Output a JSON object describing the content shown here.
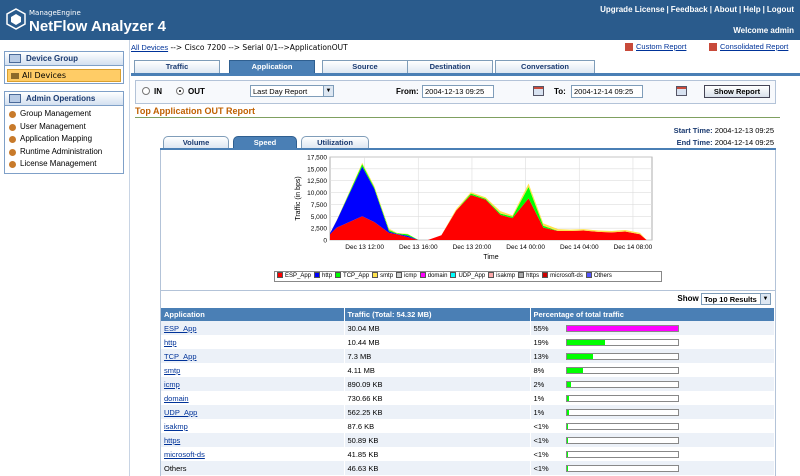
{
  "app": {
    "brand_small": "ManageEngine",
    "brand_name": "NetFlow Analyzer 4",
    "links": [
      "Upgrade License",
      "Feedback",
      "About",
      "Help",
      "Logout"
    ],
    "welcome": "Welcome admin"
  },
  "sidebar": {
    "device_group_title": "Device Group",
    "device_group_item": "All Devices",
    "admin_title": "Admin Operations",
    "admin_items": [
      "Group Management",
      "User Management",
      "Application Mapping",
      "Runtime Administration",
      "License Management"
    ]
  },
  "breadcrumb": {
    "root": "All Devices",
    "path": " --> Cisco 7200 --> Serial 0/1-->ApplicationOUT"
  },
  "report_links": {
    "custom": "Custom Report",
    "consolidated": "Consolidated Report"
  },
  "tabs": [
    "Traffic",
    "Application",
    "Source",
    "Destination",
    "Conversation"
  ],
  "filter": {
    "in_label": "IN",
    "out_label": "OUT",
    "period": "Last Day Report",
    "from_label": "From:",
    "from_value": "2004-12-13 09:25",
    "to_label": "To:",
    "to_value": "2004-12-14 09:25",
    "show_button": "Show Report"
  },
  "report": {
    "title": "Top Application OUT Report",
    "start_label": "Start Time:",
    "start_value": "2004-12-13 09:25",
    "end_label": "End Time:",
    "end_value": "2004-12-14 09:25"
  },
  "subtabs": [
    "Volume",
    "Speed",
    "Utilization"
  ],
  "chart_data": {
    "type": "area",
    "title": "",
    "xlabel": "Time",
    "ylabel": "Traffic (in bps)",
    "ylim": [
      0,
      17500
    ],
    "yticks": [
      "0",
      "2,500",
      "5,000",
      "7,500",
      "10,000",
      "12,500",
      "15,000",
      "17,500"
    ],
    "xtick_labels": [
      "Dec 13 12:00",
      "Dec 13 16:00",
      "Dec 13 20:00",
      "Dec 14 00:00",
      "Dec 14 04:00",
      "Dec 14 08:00"
    ],
    "xtick_hours": [
      2.58,
      6.58,
      10.58,
      14.58,
      18.58,
      22.58
    ],
    "x_hours": [
      0,
      0.5,
      2.4,
      3.3,
      4.4,
      5,
      5.8,
      6.6,
      7.3,
      8.3,
      9.4,
      10.5,
      11.6,
      12.7,
      13.6,
      14.8,
      15.9,
      17,
      17.9,
      18.9,
      20,
      21,
      22,
      23.1,
      23.6
    ],
    "series": [
      {
        "name": "ESP_App",
        "color": "#ff0000",
        "values": [
          1200,
          2600,
          5000,
          3800,
          1500,
          1200,
          600,
          0,
          0,
          1000,
          6200,
          9500,
          8500,
          5300,
          4600,
          8800,
          2600,
          1900,
          1900,
          2000,
          1700,
          1600,
          1800,
          1200,
          0
        ]
      },
      {
        "name": "http",
        "color": "#0000ff",
        "values": [
          200,
          1500,
          10500,
          7000,
          300,
          100,
          300,
          0,
          0,
          0,
          0,
          0,
          0,
          0,
          0,
          0,
          0,
          0,
          0,
          0,
          0,
          0,
          0,
          0,
          0
        ]
      },
      {
        "name": "TCP_App",
        "color": "#00ff00",
        "values": [
          0,
          0,
          500,
          300,
          300,
          100,
          300,
          0,
          0,
          0,
          0,
          300,
          200,
          300,
          300,
          2400,
          400,
          0,
          0,
          0,
          0,
          0,
          0,
          0,
          0
        ]
      },
      {
        "name": "smtp",
        "color": "#ffe34d",
        "values": [
          0,
          100,
          300,
          300,
          300,
          100,
          100,
          0,
          0,
          0,
          300,
          300,
          300,
          500,
          300,
          700,
          500,
          400,
          300,
          300,
          300,
          300,
          300,
          300,
          0
        ]
      },
      {
        "name": "icmp",
        "color": "#cccccc",
        "values": [
          0,
          0,
          0,
          0,
          0,
          0,
          0,
          0,
          0,
          0,
          0,
          0,
          0,
          0,
          0,
          0,
          0,
          0,
          0,
          0,
          0,
          0,
          0,
          0,
          0
        ]
      },
      {
        "name": "domain",
        "color": "#ff00ff",
        "values": [
          0,
          0,
          0,
          0,
          0,
          0,
          0,
          0,
          0,
          0,
          0,
          0,
          0,
          0,
          0,
          0,
          0,
          0,
          0,
          0,
          0,
          0,
          0,
          0,
          0
        ]
      },
      {
        "name": "UDP_App",
        "color": "#00ffff",
        "values": [
          0,
          0,
          0,
          0,
          0,
          0,
          0,
          0,
          0,
          0,
          0,
          0,
          0,
          0,
          0,
          0,
          0,
          0,
          0,
          0,
          0,
          0,
          0,
          0,
          0
        ]
      },
      {
        "name": "isakmp",
        "color": "#ffaaaa",
        "values": [
          0,
          0,
          0,
          0,
          0,
          0,
          0,
          0,
          0,
          0,
          0,
          0,
          0,
          0,
          0,
          0,
          0,
          0,
          0,
          0,
          0,
          0,
          0,
          0,
          0
        ]
      },
      {
        "name": "https",
        "color": "#aaaaaa",
        "values": [
          0,
          0,
          0,
          0,
          0,
          0,
          0,
          0,
          0,
          0,
          0,
          0,
          0,
          0,
          0,
          0,
          0,
          0,
          0,
          0,
          0,
          0,
          0,
          0,
          0
        ]
      },
      {
        "name": "microsoft-ds",
        "color": "#cc0000",
        "values": [
          0,
          0,
          0,
          0,
          0,
          0,
          0,
          0,
          0,
          0,
          0,
          0,
          0,
          0,
          0,
          0,
          0,
          0,
          0,
          0,
          0,
          0,
          0,
          0,
          0
        ]
      },
      {
        "name": "Others",
        "color": "#5555ff",
        "values": [
          0,
          0,
          0,
          0,
          0,
          0,
          0,
          0,
          0,
          0,
          0,
          0,
          0,
          0,
          0,
          0,
          0,
          0,
          0,
          0,
          0,
          0,
          0,
          0,
          0
        ]
      }
    ],
    "grid": true
  },
  "table": {
    "show_label": "Show",
    "show_value": "Top 10 Results",
    "headers": [
      "Application",
      "Traffic (Total: 54.32 MB)",
      "Percentage of total traffic"
    ],
    "rows": [
      {
        "app": "ESP_App",
        "link": true,
        "traffic": "30.04 MB",
        "pct": "55%",
        "share": 0.55,
        "color": "#ff00ff"
      },
      {
        "app": "http",
        "link": true,
        "traffic": "10.44 MB",
        "pct": "19%",
        "share": 0.19,
        "color": "#00ff00"
      },
      {
        "app": "TCP_App",
        "link": true,
        "traffic": "7.3 MB",
        "pct": "13%",
        "share": 0.13,
        "color": "#00ff00"
      },
      {
        "app": "smtp",
        "link": true,
        "traffic": "4.11 MB",
        "pct": "8%",
        "share": 0.08,
        "color": "#00ff00"
      },
      {
        "app": "icmp",
        "link": true,
        "traffic": "890.09 KB",
        "pct": "2%",
        "share": 0.02,
        "color": "#00ff00"
      },
      {
        "app": "domain",
        "link": true,
        "traffic": "730.66 KB",
        "pct": "1%",
        "share": 0.01,
        "color": "#00ff00"
      },
      {
        "app": "UDP_App",
        "link": true,
        "traffic": "562.25 KB",
        "pct": "1%",
        "share": 0.01,
        "color": "#00ff00"
      },
      {
        "app": "isakmp",
        "link": true,
        "traffic": "87.6 KB",
        "pct": "<1%",
        "share": 0.005,
        "color": "#00ff00"
      },
      {
        "app": "https",
        "link": true,
        "traffic": "50.89 KB",
        "pct": "<1%",
        "share": 0.005,
        "color": "#00ff00"
      },
      {
        "app": "microsoft-ds",
        "link": true,
        "traffic": "41.85 KB",
        "pct": "<1%",
        "share": 0.005,
        "color": "#00ff00"
      },
      {
        "app": "Others",
        "link": false,
        "traffic": "46.63 KB",
        "pct": "<1%",
        "share": 0.005,
        "color": "#00ff00"
      }
    ]
  }
}
